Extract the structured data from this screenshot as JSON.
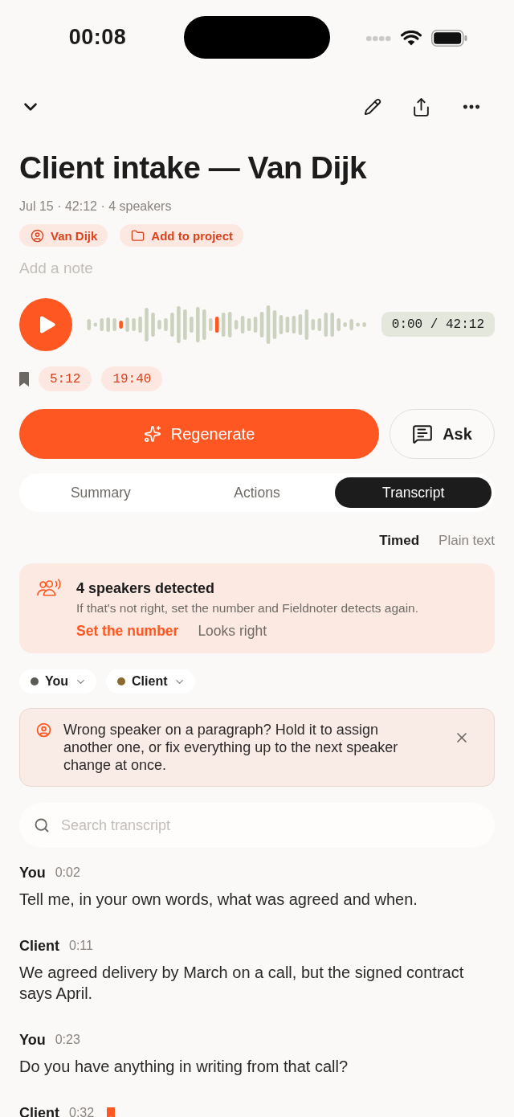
{
  "status_bar": {
    "time": "00:08"
  },
  "title": "Client intake — Van Dijk",
  "meta": "Jul 15 · 42:12 · 4 speakers",
  "chips": [
    {
      "kind": "person",
      "label": "Van Dijk"
    },
    {
      "kind": "folder",
      "label": "Add to project"
    }
  ],
  "note": {
    "placeholder": "Add a note"
  },
  "player": {
    "time": "0:00 / 42:12"
  },
  "bookmarks": [
    "5:12",
    "19:40"
  ],
  "actions": [
    {
      "kind": "primary",
      "label": "Regenerate"
    },
    {
      "kind": "secondary",
      "label": "Ask"
    }
  ],
  "tabs": [
    {
      "label": "Summary",
      "selected": false
    },
    {
      "label": "Actions",
      "selected": false
    },
    {
      "label": "Transcript",
      "selected": true
    }
  ],
  "view_modes": [
    {
      "label": "Timed",
      "selected": true
    },
    {
      "label": "Plain text",
      "selected": false
    }
  ],
  "speakers_notice": {
    "title": "4 speakers detected",
    "message": "If that's not right, set the number and Fieldnoter detects again.",
    "links": [
      {
        "kind": "primary",
        "label": "Set the number"
      },
      {
        "kind": "secondary",
        "label": "Looks right"
      }
    ]
  },
  "speaker_filters": [
    {
      "label": "You",
      "color": "#5a5955"
    },
    {
      "label": "Client",
      "color": "#8b6a32"
    }
  ],
  "tip": {
    "message": "Wrong speaker on a paragraph? Hold it to assign another one, or fix everything up to the next speaker change at once."
  },
  "search": {
    "placeholder": "Search transcript"
  },
  "transcript": [
    {
      "speaker": "You",
      "time": "0:02",
      "text": "Tell me, in your own words, what was agreed and when.",
      "bookmarked": false
    },
    {
      "speaker": "Client",
      "time": "0:11",
      "text": "We agreed delivery by March on a call, but the signed contract says April.",
      "bookmarked": false
    },
    {
      "speaker": "You",
      "time": "0:23",
      "text": "Do you have anything in writing from that call?",
      "bookmarked": false
    },
    {
      "speaker": "Client",
      "time": "0:32",
      "bookmarked": true
    }
  ]
}
